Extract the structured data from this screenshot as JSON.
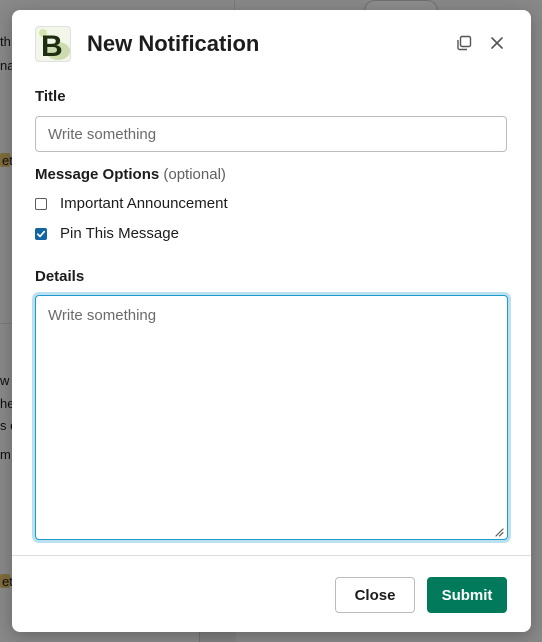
{
  "background": {
    "fragments": [
      "th",
      "na",
      "et",
      "w",
      "he",
      "s e",
      "m",
      "et"
    ]
  },
  "modal": {
    "app_logo_letter": "B",
    "title": "New Notification",
    "header_icons": {
      "popout": "popout-window-icon",
      "close": "close-icon"
    }
  },
  "form": {
    "title_label": "Title",
    "title_placeholder": "Write something",
    "title_value": "",
    "options_label": "Message Options",
    "options_optional": "(optional)",
    "options": [
      {
        "label": "Important Announcement",
        "checked": false
      },
      {
        "label": "Pin This Message",
        "checked": true
      }
    ],
    "details_label": "Details",
    "details_placeholder": "Write something",
    "details_value": ""
  },
  "footer": {
    "close_label": "Close",
    "submit_label": "Submit"
  },
  "colors": {
    "submit_bg": "#007a5a",
    "checkbox_checked": "#1264a3",
    "focus_ring": "#1d9bd1"
  }
}
